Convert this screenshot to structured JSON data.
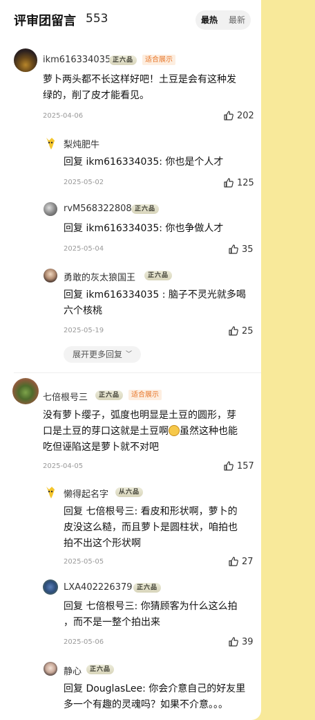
{
  "header": {
    "title": "评审团留言",
    "count": "553",
    "sort_hot": "最热",
    "sort_new": "最新"
  },
  "comments": [
    {
      "user": "ikm616334035",
      "badge": "正六品",
      "tag": "适合展示",
      "text_line1": "萝卜两头都不长这样好吧！土豆是会有这种发",
      "text_line2": "绿的，削了皮才能看见。",
      "date": "2025-04-06",
      "likes": "202",
      "replies": [
        {
          "user": "梨炖肥牛",
          "text": "回复 ikm616334035: 你也是个人才",
          "date": "2025-05-02",
          "likes": "125"
        },
        {
          "user": "rvM568322808",
          "badge": "正六品",
          "text": "回复 ikm616334035: 你也争做人才",
          "date": "2025-05-04",
          "likes": "35"
        },
        {
          "user": "勇敢的灰太狼国王",
          "badge": "正六品",
          "text_line1": "回复 ikm616334035 : 脑子不灵光就多喝",
          "text_line2": "六个核桃",
          "date": "2025-05-19",
          "likes": "25"
        }
      ],
      "expand_label": "展开更多回复"
    },
    {
      "user": "七倍根号三",
      "badge": "正六品",
      "tag": "适合展示",
      "text_line1": "没有萝卜缨子，弧度也明显是土豆的圆形，芽",
      "text_line2a": "口是土豆的芽口这就是土豆啊",
      "text_line2b": "虽然这种也能",
      "text_line3": "吃但诬陷这是萝卜就不对吧",
      "emoji_icon": "sweat-smile-emoji",
      "date": "2025-04-05",
      "likes": "157",
      "replies": [
        {
          "user": "懒得起名字",
          "badge": "从六品",
          "text_line1": "回复 七倍根号三: 看皮和形状啊，萝卜的",
          "text_line2": "皮没这么糙，而且萝卜是圆柱状，咱拍也",
          "text_line3": "拍不出这个形状啊",
          "date": "2025-05-05",
          "likes": "27"
        },
        {
          "user": "LXA402226379",
          "badge": "正六品",
          "text_line1": "回复 七倍根号三: 你猜顾客为什么这么拍",
          "text_line2": "，而不是一整个拍出来",
          "date": "2025-05-06",
          "likes": "39"
        },
        {
          "user": "静心",
          "badge": "正六品",
          "text_line1": "回复 DouglasLee: 你会介意自己的好友里",
          "text_line2": "多一个有趣的灵魂吗？如果不介意。。。"
        }
      ]
    }
  ],
  "colors": {
    "page_bg": "#f8e99a",
    "panel_bg": "#ffffff",
    "tag_orange": "#e7762a"
  }
}
